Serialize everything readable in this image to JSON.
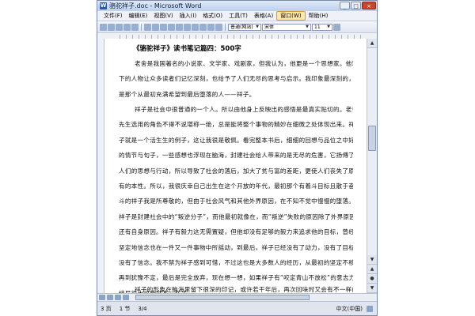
{
  "window": {
    "title": "骆驼祥子.doc - Microsoft Word",
    "controls": [
      "_",
      "□",
      "×"
    ]
  },
  "menu": [
    {
      "label": "文件(F)"
    },
    {
      "label": "编辑(E)"
    },
    {
      "label": "视图(V)"
    },
    {
      "label": "插入(I)"
    },
    {
      "label": "格式(O)"
    },
    {
      "label": "工具(T)"
    },
    {
      "label": "表格(A)"
    },
    {
      "label": "窗口(W)",
      "active": true
    },
    {
      "label": "帮助(H)"
    }
  ],
  "toolbar": {
    "style_combo": "普通(网站)",
    "font_combo": "宋体",
    "size_combo": "11"
  },
  "document": {
    "title": "《骆驼祥子》读书笔记篇四：500字",
    "paragraphs": [
      [
        "老舍是我国著名的小说家、文学家、戏剧家，但我认为，他更是一个思想家。他笔",
        "下的人物让众多读者们记忆深刻，也给予了人们无尽的思考与启示。我印象最深刻的，",
        "是那个从最初充满希望到最后堕落的人——祥子。"
      ],
      [
        "祥子是社会中很普通的一个人。所以由他身上反映出的感悟是最真实贴切的。老舍",
        "先生选用的角色不得不说堪称一绝，总是能将整个事物的精妙在细微之处体现出来。祥",
        "子就是一个活生生的例子，这让我很是敬佩。看完整本书后，细细的回想与品位之中好",
        "的情节与句子，一些感想也浮现在脑海，封建社会给人带来的是无尽的危害，它扬傅了",
        "人们的思想与行动，所以导致了社会的落后，加大了贫与富的差距，更使人们丧失了原",
        "有的本性。所以，我很庆幸自己出生在这个开放的年代，最初那个有着斗目标且散于奋",
        "斗的祥子我是所尊敬的，但由于社会风气和其他外界原因，在不知不觉中慢慢的堕落。",
        "祥子是封建社会中的“叛逆分子”，而他最初就像在，而“叛逆”失败的原因除了外界原因，",
        "还有自身原因。祥子有毅力这无需置疑，但他却没有足够的毅力来追求他的目标，曾经",
        "坚定地信念也在一件又一件事物中所摇动，到最后，祥子已经没有了动力，没有了目标，",
        "没有了信念。我不禁为祥子感到可惜，不过这也是大多数人的经历，从最初的坚定不移",
        "再到犹豫不定，最后是完全放弃，现在想一想，如果祥子有“咬定青山不放松”的意志力，",
        "结局很大可能就不一样了。"
      ],
      [
        "祥子的形象在脑海里留下很深的印记，或许若干年后，再次回味时又会有不一样的"
      ]
    ]
  },
  "status": {
    "page": "3 页",
    "section": "1 节",
    "pages": "3/4",
    "lang": "中文(中国)"
  }
}
